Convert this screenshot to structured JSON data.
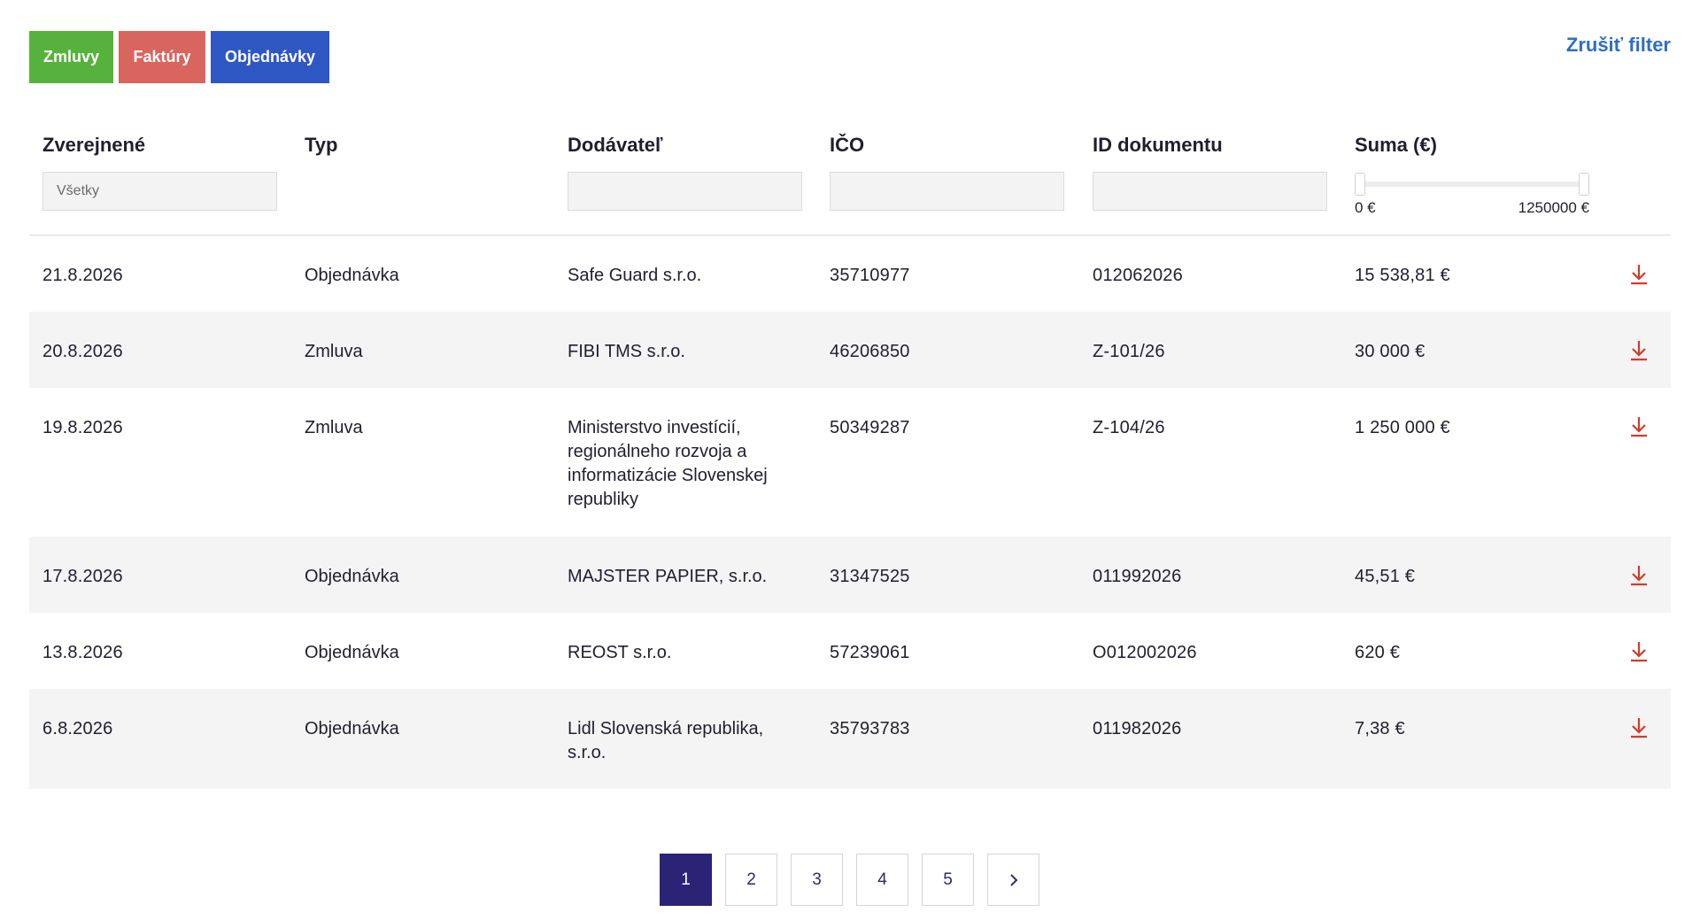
{
  "filters": {
    "buttons": [
      {
        "label": "Zmluvy",
        "color": "#56b23c"
      },
      {
        "label": "Faktúry",
        "color": "#d9655f"
      },
      {
        "label": "Objednávky",
        "color": "#2f57c4"
      }
    ],
    "clear_label": "Zrušiť filter"
  },
  "table": {
    "headers": [
      "Zverejnené",
      "Typ",
      "Dodávateľ",
      "IČO",
      "ID dokumentu",
      "Suma (€)"
    ],
    "published_filter_placeholder": "Všetky",
    "amount_range": {
      "min_label": "0 €",
      "max_label": "1250000 €"
    },
    "rows": [
      {
        "date": "21.8.2026",
        "type": "Objednávka",
        "supplier": "Safe Guard s.r.o.",
        "ico": "35710977",
        "doc_id": "012062026",
        "amount": "15 538,81 €"
      },
      {
        "date": "20.8.2026",
        "type": "Zmluva",
        "supplier": "FIBI TMS s.r.o.",
        "ico": "46206850",
        "doc_id": "Z-101/26",
        "amount": "30 000 €"
      },
      {
        "date": "19.8.2026",
        "type": "Zmluva",
        "supplier": "Ministerstvo investícií, regionálneho rozvoja a informatizácie Slovenskej republiky",
        "ico": "50349287",
        "doc_id": "Z-104/26",
        "amount": "1 250 000 €"
      },
      {
        "date": "17.8.2026",
        "type": "Objednávka",
        "supplier": "MAJSTER PAPIER, s.r.o.",
        "ico": "31347525",
        "doc_id": "011992026",
        "amount": "45,51 €"
      },
      {
        "date": "13.8.2026",
        "type": "Objednávka",
        "supplier": "REOST s.r.o.",
        "ico": "57239061",
        "doc_id": "O012002026",
        "amount": "620 €"
      },
      {
        "date": "6.8.2026",
        "type": "Objednávka",
        "supplier": "Lidl Slovenská republika, s.r.o.",
        "ico": "35793783",
        "doc_id": "011982026",
        "amount": "7,38 €"
      }
    ]
  },
  "pagination": {
    "pages": [
      "1",
      "2",
      "3",
      "4",
      "5"
    ],
    "active": "1",
    "next_icon": "chevron-right-icon"
  },
  "colors": {
    "accent_link": "#2f6fc0",
    "download_icon": "#d33a2c",
    "active_page": "#2a2376"
  }
}
